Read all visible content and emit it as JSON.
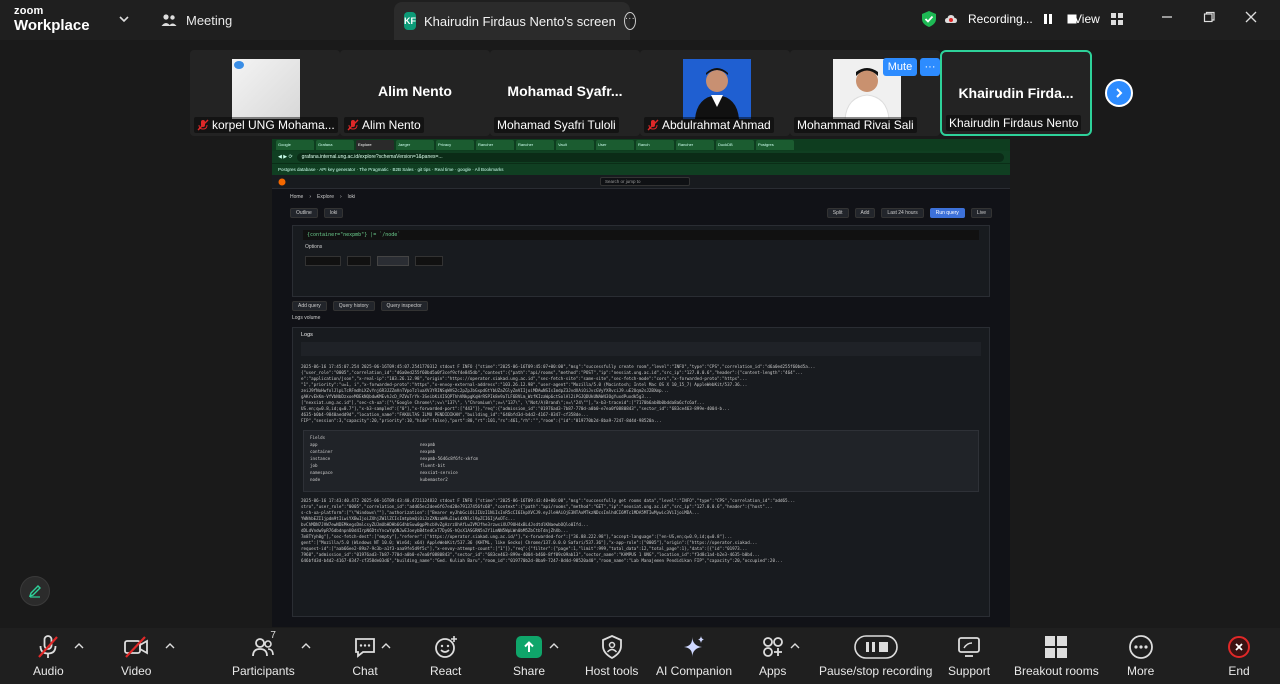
{
  "app": {
    "logo_line1": "zoom",
    "logo_line2": "Workplace"
  },
  "top_tabs": {
    "meeting_label": "Meeting",
    "screen_initials": "KF",
    "screen_title": "Khairudin Firdaus Nento's screen"
  },
  "recording": {
    "label": "Recording..."
  },
  "view": {
    "label": "View"
  },
  "participants_strip": [
    {
      "big_name": "",
      "label": "korpel UNG Mohama...",
      "muted": true,
      "has_photo": true
    },
    {
      "big_name": "Alim Nento",
      "label": "Alim Nento",
      "muted": true
    },
    {
      "big_name": "Mohamad Syafr...",
      "label": "Mohamad Syafri Tuloli",
      "muted": false
    },
    {
      "big_name": "",
      "label": "Abdulrahmat Ahmad",
      "muted": true,
      "has_photo": true
    },
    {
      "big_name": "",
      "label": "Mohammad Rivai Sali",
      "muted": false,
      "has_photo": true
    },
    {
      "big_name": "Khairudin Firda...",
      "label": "Khairudin Firdaus Nento",
      "muted": false,
      "active": true
    }
  ],
  "tile_actions": {
    "mute": "Mute",
    "more": "···"
  },
  "shared_screen": {
    "url": "grafana.internal.ung.ac.id/explore?schemaVersion=1&panes=...",
    "search_placeholder": "Search or jump to",
    "breadcrumb": [
      "Home",
      "Explore",
      "loki"
    ],
    "outline": "Outline",
    "datasource": "loki",
    "split": "Split",
    "add": "Add",
    "time_range": "Last 24 hours",
    "run_query": "Run query",
    "live": "Live",
    "query_code": "{container=\"nexpmb\"} |= `/node`",
    "options": "Options",
    "add_query": "Add query",
    "query_history": "Query history",
    "query_inspector": "Query inspector",
    "logs_volume": "Logs volume",
    "logs": "Logs",
    "log_lines": [
      "2025-06-16 17:45:07.254  2025-06-16T09:45:07.2541770312 stdout F  INFO {\"stime\":\"2025-06-16T09:45:07+00:00\",\"msg\":\"successfully create room\",\"level\":\"INFO\",\"type\":\"CPS\",\"correlation_id\":\"d6a0ed255f60bd5a...",
      "{\"user_role\":\"0005\",\"correlation_id\":\"d6a0ed255f60bd5a0f3cef9cf4e845db\",\"context\":{\"path\":\"api/rooms\",\"method\":\"POST\",\"ip\":\"nexsiat.ung.ac.id\",\"src_ip\":\"127.0.0.6\",\"header\":{\"content-length\":\"464\"...",
      "e\":\"application/json\",\"x-real-ip\":\"103.26.12.98\",\"origin\":\"https://operator.siakad.ung.ac.id\",\"sec-fetch-site\":\"same-site\",\"sec-fetch-mode\":\"cors\",\"x-forwarded-proto\":\"https\"...",
      "\"1\",\"priority\":\"u=1, i\",\"x-forwarded-proto\":\"https\",\"x-envoy-external-address\":\"103.26.12.98\",\"user-agent\":\"Mozilla/5.0 (Macintosh; Intel Mac OS X 10_15_7) AppleWebKit/537.36...",
      "zeiJ9fNoHwfolJlpLTcRFmdhLXZvYnj6R3JZZmVnTVpoTzluaXV3YRINSqWVS2c2pZpJbGxpdGtYbUZaZGlyZmVIIjoiMDAwNSIsImdpZ3JvdXAiOiJvcGVyYXRvciJ9.uE2Uqm2sJ2BXmp...",
      "gAKrvEkKm-VfVbNbDzxoeMOEkNQbdwKMEvhJcD_PZVuTrYk-3SeibKiXISQPThhVNkpgKqHrRSPIk8e9aTLF6BVLm_WzfKIzaWp6ctSolAl2iPGJQDUkUNAW43OgYuxdPuxdk5g3...",
      "[\"nexsiat.ung.ac.id\"],\"sec-ch-ua\":[\"\\\"Google Chrome\\\";v=\\\"137\\\", \\\"Chromium\\\";v=\\\"137\\\", \\\"Not/A)Brand\\\";v=\\\"24\\\"\"],\"x-b3-traceid\":[\"7170b6ab8b0bdda8a6cfc6af...",
      "US.en;q=0.8,id;q=0.7\"],\"x-b3-sampled\":[\"0\"],\"x-forwarded-port\":[\"443\"]},\"req\":{\"admission_id\":\"01976ad3-7b87-770d-a0b0-e7ea0f0880843\",\"sector_id\":\"683ce463-899e-4004-b...",
      "4635-b0b4-9840aedd9d\",\"location_name\":\"FAKULTAS ILMU PENDIDIKAN\",\"building_id\":\"646bfd3d-b4d2-4167-8347-cf358de...",
      "FIP\",\"session\":3,\"capacity\":20,\"priority\":10,\"hide\":false},\"port\":80,\"rt\":101,\"rs\":461,\"rh\":\"\",\"room\":{\"id\":\"019770b2d-8ba9-7247-8d4d-98520a..."
    ],
    "fields_title": "Fields",
    "fields": [
      {
        "key": "app",
        "value": "nexpmb"
      },
      {
        "key": "container",
        "value": "nexpmb"
      },
      {
        "key": "instance",
        "value": "nexpmb-5646c8f6fc-xkfcm"
      },
      {
        "key": "job",
        "value": "fluent-bit"
      },
      {
        "key": "namespace",
        "value": "nexsiat-service"
      },
      {
        "key": "node",
        "value": "kubemaster2"
      }
    ],
    "log_lines_2": [
      "2025-06-16 17:43:40.472  2025-06-16T09:43:40.4721124832 stdout F  INFO {\"stime\":\"2025-06-16T09:43:40+00:00\",\"msg\":\"successfully get rooms data\",\"level\":\"INFO\",\"type\":\"CPS\",\"correlation_id\":\"add65...",
      "stro\",\"user_role\":\"0005\",\"correlation_id\":\"add65ec2dee6f67ed28e79137456fc68\",\"context\":{\"path\":\"api/rooms\",\"method\":\"GET\",\"ip\":\"nexsiat.ung.ac.id\",\"src_ip\":\"127.0.0.6\",\"header\":{\"host\"...",
      "s-ch-ua-platform\":[\"\\\"Windows\\\"\"],\"authorization\":[\"Bearer eyJhbGciOiJIUzI1NiIsInR5cCI6IkpXVCJ9.eyJleHAiOjE3NTAxMTkzNDcsImlhdCI6MTc1MDA5MTIwMywic3ViIjoiMDA...",
      "YWNhbEZI1jpdm9tIiwiYXBwIjoiZXhjZW1lZCIsImtpbmQiOiJzZXNzaW9uIiwidXNlcl9pZCI6IjAxOTc...",
      "bvChMDN7JVW7ewNDEMkegsDmlcsyZUJmUbHDHb6G4hbSuw0gpPhcbVvZgAzrzOhAfLwIVMJfhe3rzwsiXU79UH4xBL4JsdtdlKNaewbOQlo0Ifd...",
      "dDLdVndw9pR76dbdnpnU0d4IrpN6DtsYncwYqONJwEJoeybB4tedCeT7Dy0S-hQsX1ASGRN5n2Y1LmNN5WpLWn0bM5ZbCtbTdnjZhXb...",
      "7m8TYyh0g\"],\"sec-fetch-dest\":[\"empty\"],\"referer\":[\"https://operator.siakad.ung.ac.id/\"],\"x-forwarded-for\":[\"36.88.222.98\"],\"accept-language\":[\"en-US,en;q=0.9,id;q=0.8\"]...",
      "gent\":[\"Mozilla/5.0 (Windows NT 10.0; Win64; x64) AppleWebKit/537.36 (KHTML, like Gecko) Chrome/137.0.0.0 Safari/537.36\"],\"x-app-role\":[\"0005\"],\"origin\":[\"https://operator.siakad...",
      "request-id\":[\"aab66ee2-89a7-9c3b-a1f3-aaa9fe5d9f5c\"],\"x-envoy-attempt-count\":[\"1\"]},\"req\":{\"filter\":{\"page\":1,\"limit\":999,\"total_data\":12,\"total_page\":1},\"data\":[{\"id\":\"01973...",
      "7960\",\"admission_id\":\"01976ad3-7b87-770d-a0b0-e7ea0f0880843\",\"sector_id\":\"683ce463-899e-4004-b460-8ff09c09ab13\",\"sector_name\":\"KAMPUS 1 UNG\",\"location_id\":\"f3d8c1a4-b2e3-4635-b0b4...",
      "646bfd3d-b4d2-4167-8347-cf358de03d6\",\"building_name\":\"Ged. Kuliah Baru\",\"room_id\":\"019770b2d-8ba9-7247-8d4d-98520a40\",\"room_name\":\"Lab Manajemen Pendidikan FIP\",\"capacity\":20,\"occupied\":20..."
    ]
  },
  "toolbar": [
    {
      "label": "Audio",
      "icon": "mic-off-icon"
    },
    {
      "label": "Video",
      "icon": "video-off-icon"
    },
    {
      "label": "Participants",
      "icon": "participants-icon",
      "count": "7"
    },
    {
      "label": "Chat",
      "icon": "chat-icon"
    },
    {
      "label": "React",
      "icon": "react-icon"
    },
    {
      "label": "Share",
      "icon": "share-icon"
    },
    {
      "label": "Host tools",
      "icon": "host-tools-icon"
    },
    {
      "label": "AI Companion",
      "icon": "ai-companion-icon"
    },
    {
      "label": "Apps",
      "icon": "apps-icon"
    },
    {
      "label": "Pause/stop recording",
      "icon": "pause-stop-recording-icon"
    },
    {
      "label": "Support",
      "icon": "support-icon"
    },
    {
      "label": "Breakout rooms",
      "icon": "breakout-rooms-icon"
    },
    {
      "label": "More",
      "icon": "more-icon"
    },
    {
      "label": "End",
      "icon": "end-icon"
    }
  ],
  "colors": {
    "accent": "#2d8cff",
    "active_border": "#2ed29a",
    "share_green": "#0fa56a",
    "end_red": "#e02828"
  }
}
